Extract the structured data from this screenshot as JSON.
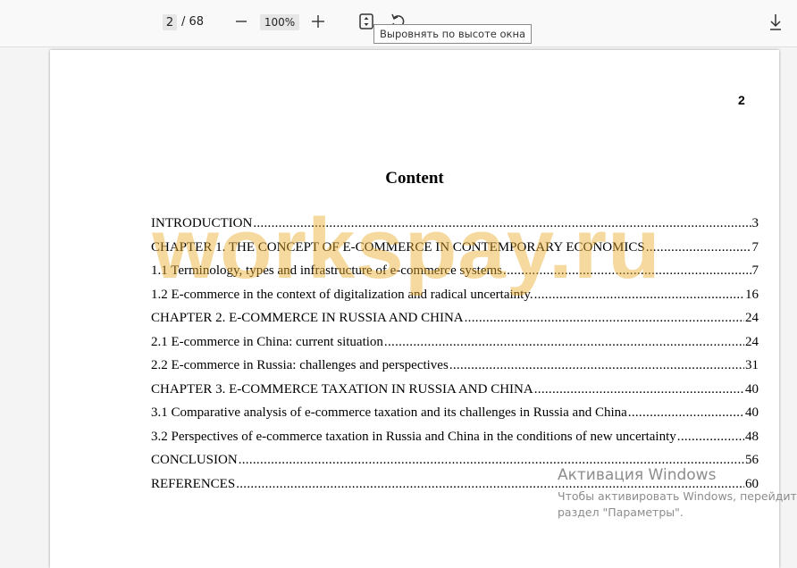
{
  "toolbar": {
    "current_page": "2",
    "total_pages": "/ 68",
    "zoom_out_symbol": "—",
    "zoom": "100%",
    "zoom_in_symbol": "+",
    "tooltip": "Выровнять по высоте окна"
  },
  "page": {
    "number": "2",
    "title": "Content",
    "toc": [
      {
        "label": "INTRODUCTION",
        "page": "3"
      },
      {
        "label": "CHAPTER 1. THE CONCEPT OF E-COMMERCE IN CONTEMPORARY ECONOMICS",
        "page": "7"
      },
      {
        "label": "1.1 Terminology, types and infrastructure of e-commerce systems",
        "page": "7"
      },
      {
        "label": "1.2 E-commerce in the context of digitalization and radical uncertainty.",
        "page": "16"
      },
      {
        "label": "CHAPTER 2. E-COMMERCE IN RUSSIA AND CHINA",
        "page": "24"
      },
      {
        "label": "2.1 E-commerce in China: current situation",
        "page": "24"
      },
      {
        "label": "2.2 E-commerce in Russia: challenges and perspectives",
        "page": "31"
      },
      {
        "label": "CHAPTER 3. E-COMMERCE TAXATION IN RUSSIA AND CHINA",
        "page": "40"
      },
      {
        "label": "3.1 Comparative analysis of e-commerce taxation and its challenges in Russia and China",
        "page": "40"
      },
      {
        "label": "3.2 Perspectives of e-commerce taxation in Russia and China in the conditions of new uncertainty",
        "page": "48"
      },
      {
        "label": "CONCLUSION",
        "page": "56"
      },
      {
        "label": "REFERENCES",
        "page": "60"
      }
    ]
  },
  "watermark": "workspay.ru",
  "windows_activation": {
    "title": "Активация Windows",
    "line1": "Чтобы активировать Windows, перейдите в",
    "line2": "раздел \"Параметры\"."
  },
  "colors": {
    "watermark": "#e8aa28",
    "page_background": "#ffffff",
    "viewer_background": "#f4f4f4"
  },
  "icons": [
    "fit-to-height-icon",
    "rotate-icon",
    "download-icon"
  ]
}
